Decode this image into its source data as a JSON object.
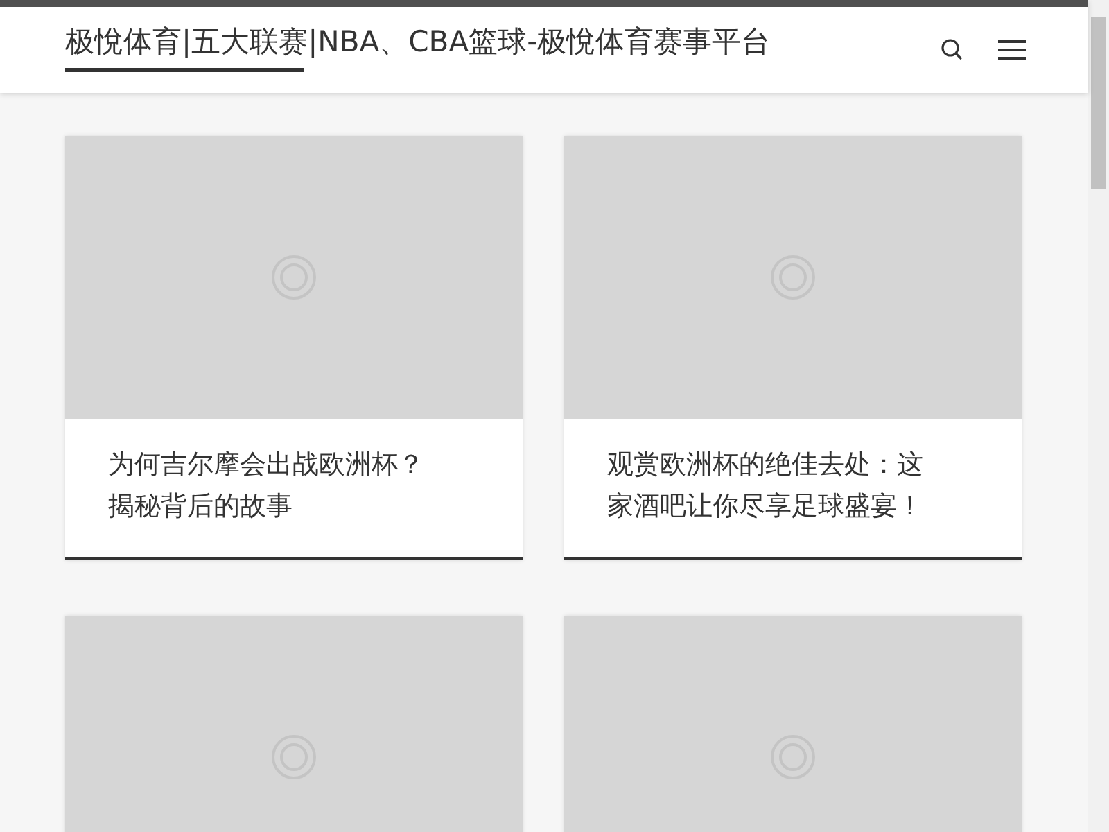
{
  "header": {
    "site_title": "极悅体育|五大联赛|NBA、CBA篮球-极悅体育赛事平台"
  },
  "posts": [
    {
      "kind": "post",
      "title": "为何吉尔摩会出战欧洲杯？揭秘背后的故事"
    },
    {
      "kind": "post",
      "title": "观赏欧洲杯的绝佳去处：这家酒吧让你尽享足球盛宴！"
    },
    {
      "kind": "image"
    },
    {
      "kind": "image"
    }
  ]
}
